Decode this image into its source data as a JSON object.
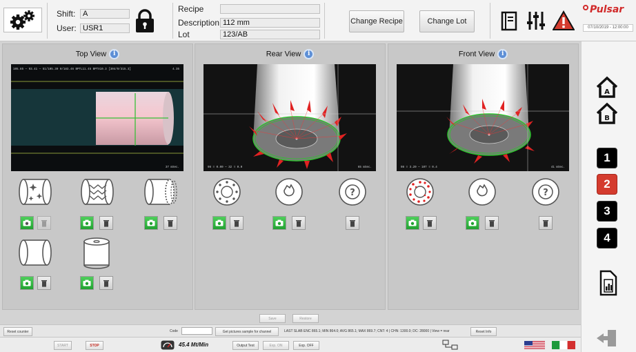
{
  "header": {
    "shift_label": "Shift:",
    "shift_value": "A",
    "user_label": "User:",
    "user_value": "USR1",
    "recipe_label": "Recipe",
    "recipe_value": "",
    "description_label": "Description",
    "description_value": "112 mm",
    "lot_label": "Lot",
    "lot_value": "123/AB",
    "change_recipe_label": "Change Recipe",
    "change_lot_label": "Change Lot",
    "brand": "Pulsar",
    "datetime": "07/10/2019 - 12:00:00",
    "icons": [
      "settings-gears-icon",
      "lock-icon",
      "manual-book-icon",
      "sliders-icon",
      "warning-icon"
    ]
  },
  "panels": [
    {
      "title": "Top View",
      "overlay_top": "105.85 — 93.41 — 51/105.30 0/183.46 BPTL11.45 BPTX10.3 [304/0/315.3]",
      "overlay_top_right": "4.35",
      "overlay_bottom_right": "37 mSec.",
      "overlay_bottom_left": ""
    },
    {
      "title": "Rear View",
      "overlay_top": "",
      "overlay_top_right": "",
      "overlay_bottom_left": "98 ≡ 0.00 — 32 ≡ 0.0",
      "overlay_bottom_right": "65 mSec."
    },
    {
      "title": "Front View",
      "overlay_top": "",
      "overlay_top_right": "",
      "overlay_bottom_left": "98 ≡ 3.20 — 107 ≡ 0.4",
      "overlay_bottom_right": "41 mSec."
    }
  ],
  "strip": {
    "save_label": "Save",
    "restore_label": "Restore"
  },
  "infobar": {
    "reset_counter_label": "Reset counter",
    "code_label": "Code",
    "code_value": "",
    "get_pictures_label": "Get pictures sample for channel",
    "stats_text": "LAST SLAB ENC 865.1; MIN 864.0; AVG 865.1; MAX 869.7; CNT: 4 | CHN: 1300.0; DC: 28000 | View = rear",
    "reset_info_label": "Reset Info"
  },
  "statusbar": {
    "start_label": "START",
    "stop_label": "STOP",
    "speed_text": "45.4  Mt/Min",
    "output_test_label": "Output Test",
    "exp_on_label": "Exp. ON",
    "exp_off_label": "Exp. OFF",
    "flags": [
      "us-flag-icon",
      "italy-flag-icon"
    ]
  },
  "nav": {
    "channels": [
      "1",
      "2",
      "3",
      "4"
    ],
    "active_channel": "2"
  },
  "colors": {
    "accent_red": "#d43b2e",
    "brand_red": "#d12a2a",
    "camera_green": "#21a231",
    "info_blue": "#5d8fd6",
    "panel_grey": "#c8c8c8"
  }
}
